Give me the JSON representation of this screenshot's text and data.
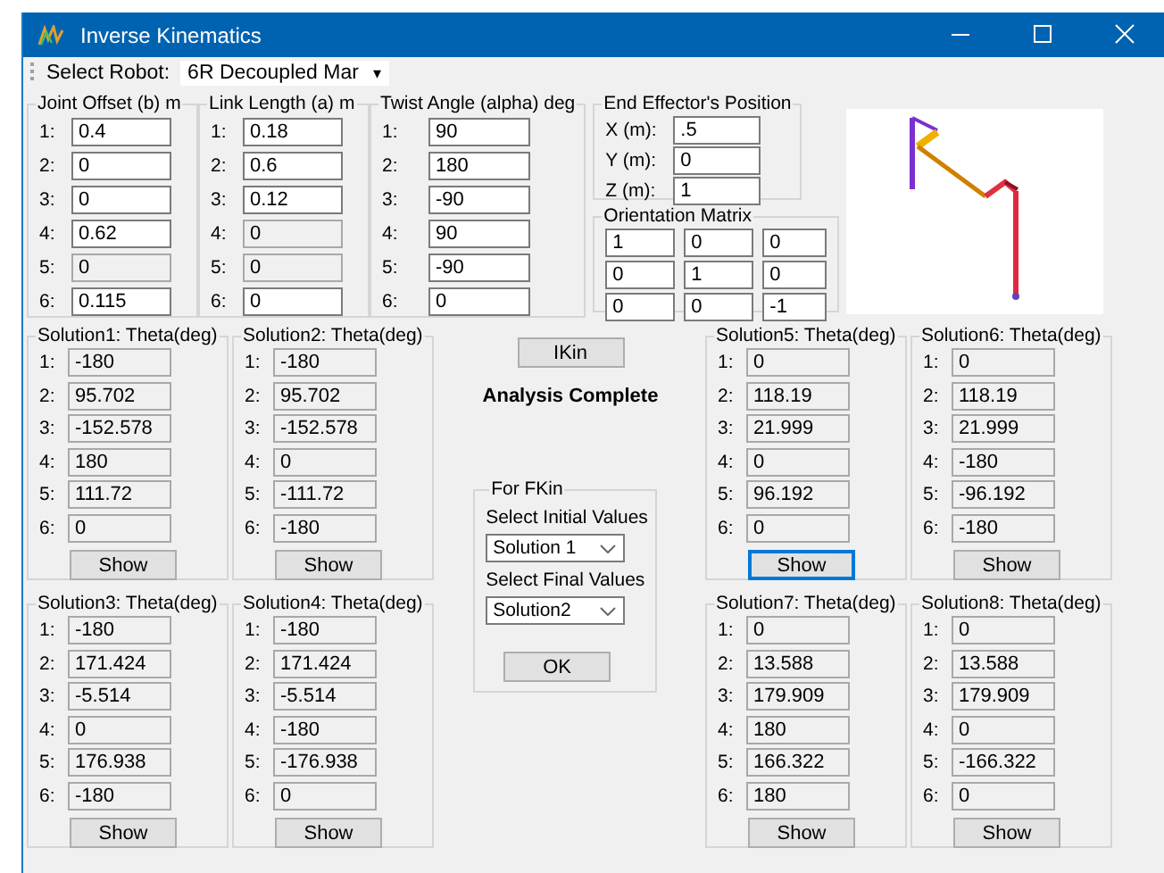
{
  "window": {
    "title": "Inverse Kinematics"
  },
  "toolbar": {
    "label": "Select Robot:",
    "robot": "6R Decoupled Mar",
    "caret": "▾"
  },
  "parameter_groups": [
    {
      "title": "Joint Offset (b) m",
      "rows": [
        {
          "index": "1:",
          "value": "0.4",
          "disabled": false
        },
        {
          "index": "2:",
          "value": "0",
          "disabled": false
        },
        {
          "index": "3:",
          "value": "0",
          "disabled": false
        },
        {
          "index": "4:",
          "value": "0.62",
          "disabled": false
        },
        {
          "index": "5:",
          "value": "0",
          "disabled": true
        },
        {
          "index": "6:",
          "value": "0.115",
          "disabled": false
        }
      ]
    },
    {
      "title": "Link Length (a) m",
      "rows": [
        {
          "index": "1:",
          "value": "0.18",
          "disabled": false
        },
        {
          "index": "2:",
          "value": "0.6",
          "disabled": false
        },
        {
          "index": "3:",
          "value": "0.12",
          "disabled": false
        },
        {
          "index": "4:",
          "value": "0",
          "disabled": true
        },
        {
          "index": "5:",
          "value": "0",
          "disabled": true
        },
        {
          "index": "6:",
          "value": "0",
          "disabled": false
        }
      ]
    },
    {
      "title": "Twist Angle (alpha) deg",
      "rows": [
        {
          "index": "1:",
          "value": "90",
          "disabled": false
        },
        {
          "index": "2:",
          "value": "180",
          "disabled": false
        },
        {
          "index": "3:",
          "value": "-90",
          "disabled": false
        },
        {
          "index": "4:",
          "value": "90",
          "disabled": false
        },
        {
          "index": "5:",
          "value": "-90",
          "disabled": false
        },
        {
          "index": "6:",
          "value": "0",
          "disabled": false
        }
      ]
    }
  ],
  "end_effector": {
    "title": "End Effector's Position",
    "rows": [
      {
        "label": "X (m):",
        "value": ".5"
      },
      {
        "label": "Y (m):",
        "value": "0"
      },
      {
        "label": "Z (m):",
        "value": "1"
      }
    ]
  },
  "orientation": {
    "title": "Orientation Matrix",
    "rows": [
      [
        "1",
        "0",
        "0"
      ],
      [
        "0",
        "1",
        "0"
      ],
      [
        "0",
        "0",
        "-1"
      ]
    ]
  },
  "ikin": {
    "button": "IKin",
    "status": "Analysis Complete"
  },
  "fkin": {
    "title": "For FKin",
    "initial_label": "Select Initial Values",
    "initial": "Solution 1",
    "final_label": "Select Final Values",
    "final": "Solution2",
    "ok": "OK"
  },
  "solutions": [
    {
      "title": "Solution1: Theta(deg)",
      "rows": [
        {
          "index": "1:",
          "value": "-180"
        },
        {
          "index": "2:",
          "value": "95.702"
        },
        {
          "index": "3:",
          "value": "-152.578"
        },
        {
          "index": "4:",
          "value": "180"
        },
        {
          "index": "5:",
          "value": "111.72"
        },
        {
          "index": "6:",
          "value": "0"
        }
      ],
      "button": "Show",
      "focused": false
    },
    {
      "title": "Solution2: Theta(deg)",
      "rows": [
        {
          "index": "1:",
          "value": "-180"
        },
        {
          "index": "2:",
          "value": "95.702"
        },
        {
          "index": "3:",
          "value": "-152.578"
        },
        {
          "index": "4:",
          "value": "0"
        },
        {
          "index": "5:",
          "value": "-111.72"
        },
        {
          "index": "6:",
          "value": "-180"
        }
      ],
      "button": "Show",
      "focused": false
    },
    {
      "title": "Solution5: Theta(deg)",
      "rows": [
        {
          "index": "1:",
          "value": "0"
        },
        {
          "index": "2:",
          "value": "118.19"
        },
        {
          "index": "3:",
          "value": "21.999"
        },
        {
          "index": "4:",
          "value": "0"
        },
        {
          "index": "5:",
          "value": "96.192"
        },
        {
          "index": "6:",
          "value": "0"
        }
      ],
      "button": "Show",
      "focused": true
    },
    {
      "title": "Solution6: Theta(deg)",
      "rows": [
        {
          "index": "1:",
          "value": "0"
        },
        {
          "index": "2:",
          "value": "118.19"
        },
        {
          "index": "3:",
          "value": "21.999"
        },
        {
          "index": "4:",
          "value": "-180"
        },
        {
          "index": "5:",
          "value": "-96.192"
        },
        {
          "index": "6:",
          "value": "-180"
        }
      ],
      "button": "Show",
      "focused": false
    },
    {
      "title": "Solution3: Theta(deg)",
      "rows": [
        {
          "index": "1:",
          "value": "-180"
        },
        {
          "index": "2:",
          "value": "171.424"
        },
        {
          "index": "3:",
          "value": "-5.514"
        },
        {
          "index": "4:",
          "value": "0"
        },
        {
          "index": "5:",
          "value": "176.938"
        },
        {
          "index": "6:",
          "value": "-180"
        }
      ],
      "button": "Show",
      "focused": false
    },
    {
      "title": "Solution4: Theta(deg)",
      "rows": [
        {
          "index": "1:",
          "value": "-180"
        },
        {
          "index": "2:",
          "value": "171.424"
        },
        {
          "index": "3:",
          "value": "-5.514"
        },
        {
          "index": "4:",
          "value": "-180"
        },
        {
          "index": "5:",
          "value": "-176.938"
        },
        {
          "index": "6:",
          "value": "0"
        }
      ],
      "button": "Show",
      "focused": false
    },
    {
      "title": "Solution7: Theta(deg)",
      "rows": [
        {
          "index": "1:",
          "value": "0"
        },
        {
          "index": "2:",
          "value": "13.588"
        },
        {
          "index": "3:",
          "value": "179.909"
        },
        {
          "index": "4:",
          "value": "180"
        },
        {
          "index": "5:",
          "value": "166.322"
        },
        {
          "index": "6:",
          "value": "180"
        }
      ],
      "button": "Show",
      "focused": false
    },
    {
      "title": "Solution8: Theta(deg)",
      "rows": [
        {
          "index": "1:",
          "value": "0"
        },
        {
          "index": "2:",
          "value": "13.588"
        },
        {
          "index": "3:",
          "value": "179.909"
        },
        {
          "index": "4:",
          "value": "0"
        },
        {
          "index": "5:",
          "value": "-166.322"
        },
        {
          "index": "6:",
          "value": "0"
        }
      ],
      "button": "Show",
      "focused": false
    }
  ]
}
